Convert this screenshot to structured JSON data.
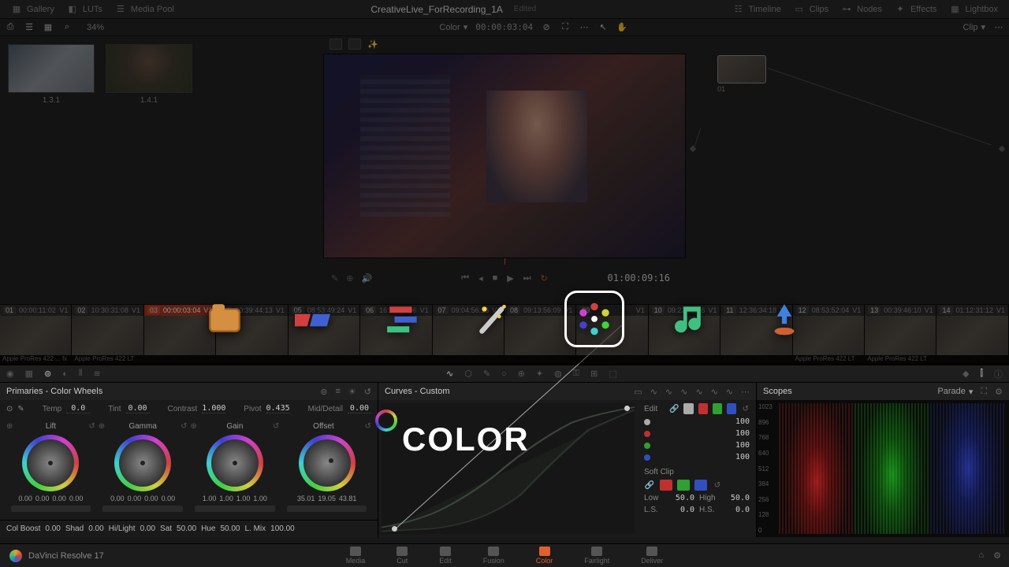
{
  "topbar": {
    "gallery": "Gallery",
    "luts": "LUTs",
    "media_pool": "Media Pool",
    "title": "CreativeLive_ForRecording_1A",
    "edited": "Edited",
    "timeline": "Timeline",
    "clips": "Clips",
    "nodes": "Nodes",
    "effects": "Effects",
    "lightbox": "Lightbox"
  },
  "subbar": {
    "zoom": "34%",
    "mode": "Color",
    "timecode": "00:00:03:04",
    "clip": "Clip"
  },
  "gallery_thumbs": [
    {
      "label": "1.3.1"
    },
    {
      "label": "1.4.1"
    }
  ],
  "viewer": {
    "tc": "01:00:09:16"
  },
  "node": {
    "label": "01"
  },
  "clips": [
    {
      "idx": "01",
      "tc": "00:00:11:02",
      "track": "V1",
      "codec": "Apple ProRes 422 ...",
      "fx": "fx"
    },
    {
      "idx": "02",
      "tc": "10:30:31:08",
      "track": "V1",
      "codec": "Apple ProRes 422 LT"
    },
    {
      "idx": "03",
      "tc": "00:00:03:04",
      "track": "V1",
      "codec": "",
      "sel": true
    },
    {
      "idx": "04",
      "tc": "00:39:44:13",
      "track": "V1",
      "codec": ""
    },
    {
      "idx": "05",
      "tc": "08:53:49:24",
      "track": "V1",
      "codec": ""
    },
    {
      "idx": "06",
      "tc": "16:28:14:06",
      "track": "V1",
      "codec": ""
    },
    {
      "idx": "07",
      "tc": "09:04:56:16",
      "track": "V1",
      "codec": ""
    },
    {
      "idx": "08",
      "tc": "09:13:56:09",
      "track": "V1",
      "codec": ""
    },
    {
      "idx": "09",
      "tc": "",
      "track": "V1",
      "codec": ""
    },
    {
      "idx": "10",
      "tc": "09:22:43:16",
      "track": "V1",
      "codec": ""
    },
    {
      "idx": "11",
      "tc": "12:36:34:18",
      "track": "V1",
      "codec": ""
    },
    {
      "idx": "12",
      "tc": "08:53:52:04",
      "track": "V1",
      "codec": "Apple ProRes 422 LT"
    },
    {
      "idx": "13",
      "tc": "00:39:46:10",
      "track": "V1",
      "codec": "Apple ProRes 422 LT"
    },
    {
      "idx": "14",
      "tc": "01:12:31:12",
      "track": "V1",
      "codec": ""
    }
  ],
  "primaries": {
    "title": "Primaries - Color Wheels",
    "temp_lbl": "Temp",
    "temp": "0.0",
    "tint_lbl": "Tint",
    "tint": "0.00",
    "contrast_lbl": "Contrast",
    "contrast": "1.000",
    "pivot_lbl": "Pivot",
    "pivot": "0.435",
    "md_lbl": "Mid/Detail",
    "md": "0.00",
    "wheels": {
      "lift": {
        "name": "Lift",
        "vals": [
          "0.00",
          "0.00",
          "0.00",
          "0.00"
        ]
      },
      "gamma": {
        "name": "Gamma",
        "vals": [
          "0.00",
          "0.00",
          "0.00",
          "0.00"
        ]
      },
      "gain": {
        "name": "Gain",
        "vals": [
          "1.00",
          "1.00",
          "1.00",
          "1.00"
        ]
      },
      "offset": {
        "name": "Offset",
        "vals": [
          "35.01",
          "19.05",
          "43.81"
        ]
      }
    },
    "bottom": {
      "colboost_lbl": "Col Boost",
      "colboost": "0.00",
      "shad_lbl": "Shad",
      "shad": "0.00",
      "hl_lbl": "Hi/Light",
      "hl": "0.00",
      "sat_lbl": "Sat",
      "sat": "50.00",
      "hue_lbl": "Hue",
      "hue": "50.00",
      "lmix_lbl": "L. Mix",
      "lmix": "100.00"
    }
  },
  "curves": {
    "title": "Curves - Custom",
    "big": "COLOR",
    "edit": "Edit",
    "vals": [
      "100",
      "100",
      "100",
      "100"
    ],
    "softclip": "Soft Clip",
    "low_lbl": "Low",
    "low": "50.0",
    "high_lbl": "High",
    "high": "50.0",
    "ls_lbl": "L.S.",
    "ls": "0.0",
    "hs_lbl": "H.S.",
    "hs": "0.0"
  },
  "scopes": {
    "title": "Scopes",
    "mode": "Parade",
    "ticks": [
      "1023",
      "896",
      "768",
      "640",
      "512",
      "384",
      "256",
      "128",
      "0"
    ]
  },
  "pages": {
    "app": "DaVinci Resolve 17",
    "items": [
      "Media",
      "Cut",
      "Edit",
      "Fusion",
      "Color",
      "Fairlight",
      "Deliver"
    ],
    "active": "Color"
  }
}
